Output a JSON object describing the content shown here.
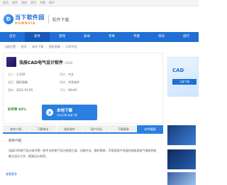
{
  "topbar": {
    "links": [
      "首页",
      "软件",
      "游戏",
      "资讯",
      "专题",
      "排行"
    ]
  },
  "header": {
    "logo_cn": "当下软件园",
    "logo_en": "DOWNXIA",
    "logo_badge": "D",
    "subtitle": "软件下载"
  },
  "nav": {
    "items": [
      "首页",
      "软件",
      "游戏",
      "安卓",
      "苹果",
      "专题",
      "资讯",
      "排行"
    ],
    "active_index": 1
  },
  "breadcrumb": [
    "当前位置",
    "首页",
    "软件下载",
    "图形图像",
    "CAD专区"
  ],
  "app": {
    "title": "浩辰CAD电气设计软件",
    "version": "2020",
    "meta": [
      {
        "k": "大小：",
        "v": "1.2GB"
      },
      {
        "k": "语言：",
        "v": "中文"
      },
      {
        "k": "类型：",
        "v": "图形图像"
      },
      {
        "k": "授权：",
        "v": "共享软件"
      },
      {
        "k": "更新：",
        "v": "2021-03-05"
      },
      {
        "k": "平台：",
        "v": "WinAll"
      }
    ],
    "rating": "好评率 92%"
  },
  "download": {
    "main": "本地下载",
    "sub": "安全无毒 高速下载"
  },
  "ad": {
    "title": "CAD",
    "button": "立即下载"
  },
  "tabs": {
    "items": [
      "软件介绍",
      "下载地址",
      "相关软件",
      "用户评论",
      "下载帮助",
      "软件截图"
    ],
    "active_index": 5
  },
  "content": {
    "section": "软件介绍",
    "description": "浩辰CAD电气设计软件是一款专业的电气设计绘图工具，功能齐全，操作简单，可帮助用户快速完成各类电气图纸的绘制与设计工作，提高设计效率。",
    "more": "查看更多"
  },
  "colors": {
    "brand": "#1f6fd4",
    "accent": "#f08a00"
  }
}
